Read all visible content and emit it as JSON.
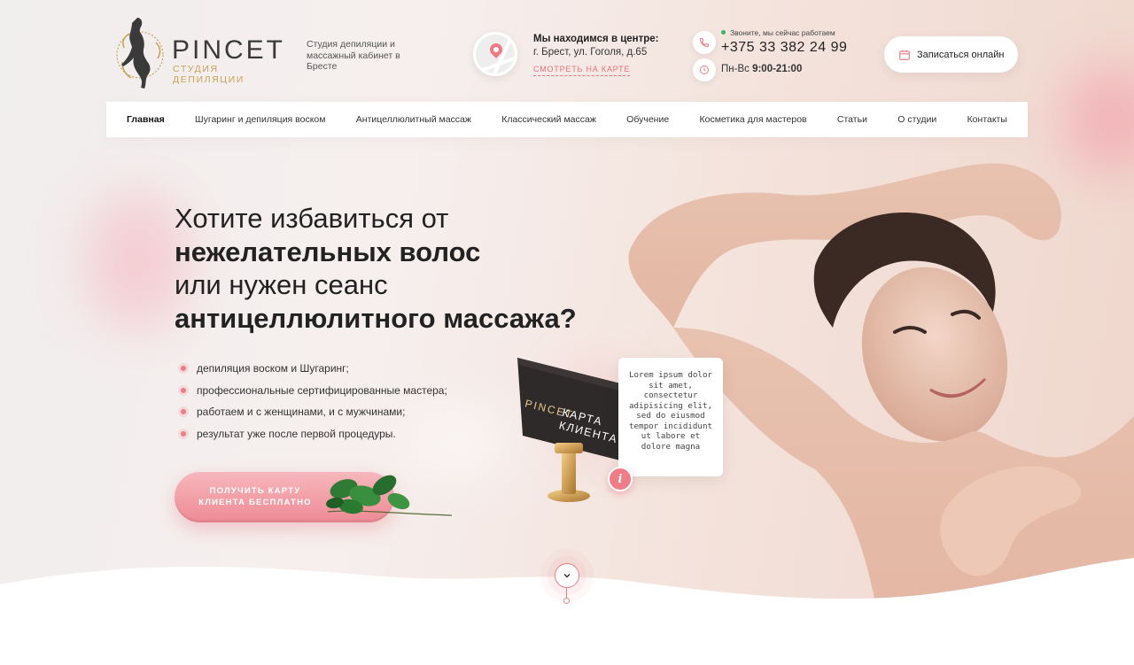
{
  "brand": {
    "name": "PINCET",
    "subtitle": "СТУДИЯ ДЕПИЛЯЦИИ",
    "tagline": "Студия депиляции и массажный кабинет в Бресте",
    "accent_color": "#ef7c86",
    "gold_color": "#c8a254"
  },
  "location": {
    "title": "Мы находимся в центре:",
    "address": "г. Брест, ул. Гоголя, д.65",
    "map_link": "СМОТРЕТЬ НА КАРТЕ",
    "icon": "map-pin-icon"
  },
  "contact": {
    "status": "Звоните, мы сейчас работаем",
    "phone": "+375 33 382 24 99",
    "hours_days": "Пн-Вс",
    "hours_time": "9:00-21:00",
    "phone_icon": "phone-icon",
    "clock_icon": "clock-icon"
  },
  "book_button": {
    "label": "Записаться онлайн",
    "icon": "calendar-icon"
  },
  "nav": [
    {
      "label": "Главная",
      "active": true
    },
    {
      "label": "Шугаринг и депиляция воском"
    },
    {
      "label": "Антицеллюлитный массаж"
    },
    {
      "label": "Классический массаж"
    },
    {
      "label": "Обучение"
    },
    {
      "label": "Косметика для мастеров"
    },
    {
      "label": "Статьи"
    },
    {
      "label": "О студии"
    },
    {
      "label": "Контакты"
    }
  ],
  "hero": {
    "line1": "Хотите избавиться от",
    "line2": "нежелательных волос",
    "line3": "или нужен сеанс",
    "line4": "антицеллюлитного массажа?",
    "bullets": [
      "депиляция воском и Шугаринг;",
      "профессиональные сертифицированные мастера;",
      "работаем и с женщинами, и с мужчинами;",
      "результат уже после первой процедуры."
    ],
    "cta_label": "ПОЛУЧИТЬ КАРТУ КЛИЕНТА БЕСПЛАТНО"
  },
  "card": {
    "brand": "PINCET",
    "title": "КАРТА КЛИЕНТА",
    "tooltip": "Lorem ipsum dolor sit amet, consectetur adipisicing elit, sed do eiusmod tempor incididunt ut labore et dolore magna",
    "info_label": "i"
  }
}
